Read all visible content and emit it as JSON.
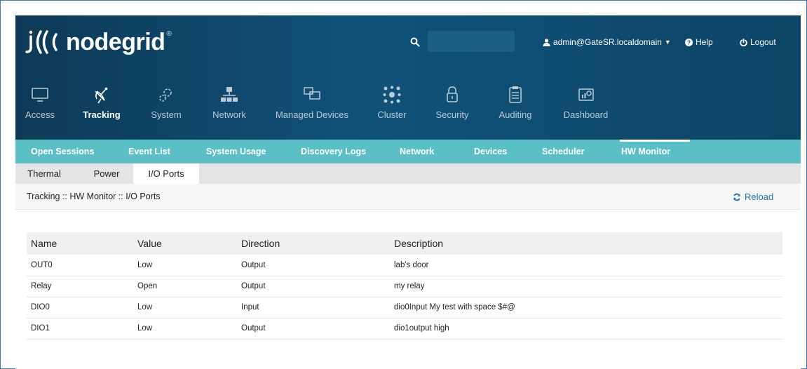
{
  "brand": {
    "name": "nodegrid",
    "registered": "®"
  },
  "header": {
    "search": {
      "placeholder": "",
      "value": ""
    },
    "user": "admin@GateSR.localdomain",
    "help": "Help",
    "logout": "Logout"
  },
  "main_nav": [
    {
      "label": "Access",
      "icon": "monitor-icon",
      "active": false
    },
    {
      "label": "Tracking",
      "icon": "satellite-dish-icon",
      "active": true
    },
    {
      "label": "System",
      "icon": "gears-icon",
      "active": false
    },
    {
      "label": "Network",
      "icon": "network-icon",
      "active": false
    },
    {
      "label": "Managed Devices",
      "icon": "devices-icon",
      "active": false
    },
    {
      "label": "Cluster",
      "icon": "cluster-icon",
      "active": false
    },
    {
      "label": "Security",
      "icon": "lock-icon",
      "active": false
    },
    {
      "label": "Auditing",
      "icon": "clipboard-icon",
      "active": false
    },
    {
      "label": "Dashboard",
      "icon": "dashboard-icon",
      "active": false
    }
  ],
  "sub_nav": [
    {
      "label": "Open Sessions"
    },
    {
      "label": "Event List"
    },
    {
      "label": "System Usage"
    },
    {
      "label": "Discovery Logs"
    },
    {
      "label": "Network"
    },
    {
      "label": "Devices"
    },
    {
      "label": "Scheduler"
    },
    {
      "label": "HW Monitor",
      "active": true
    }
  ],
  "tabs": [
    {
      "label": "Thermal"
    },
    {
      "label": "Power"
    },
    {
      "label": "I/O Ports",
      "active": true
    }
  ],
  "breadcrumb": "Tracking :: HW Monitor :: I/O Ports",
  "reload_label": "Reload",
  "table": {
    "headers": [
      "Name",
      "Value",
      "Direction",
      "Description"
    ],
    "rows": [
      [
        "OUT0",
        "Low",
        "Output",
        "lab's door"
      ],
      [
        "Relay",
        "Open",
        "Output",
        "my relay"
      ],
      [
        "DIO0",
        "Low",
        "Input",
        "dio0Input My test with space $#@"
      ],
      [
        "DIO1",
        "Low",
        "Output",
        "dio1output high"
      ]
    ]
  },
  "colors": {
    "header_dark": "#0d3a57",
    "header_mid": "#11527a",
    "subnav": "#5bbfc6",
    "link": "#1d6fb1"
  }
}
